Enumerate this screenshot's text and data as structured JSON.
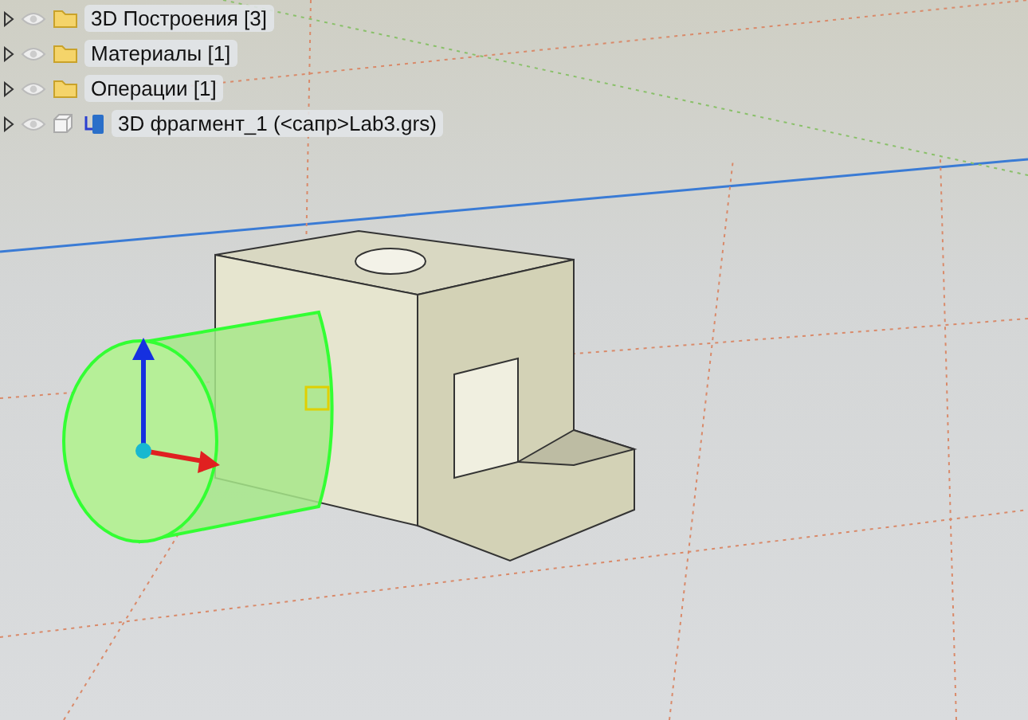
{
  "tree": {
    "items": [
      {
        "label": "3D Построения [3]",
        "kind": "folder"
      },
      {
        "label": "Материалы [1]",
        "kind": "folder"
      },
      {
        "label": "Операции [1]",
        "kind": "folder"
      },
      {
        "label": "3D фрагмент_1 (<сапр>Lab3.grs)",
        "kind": "fragment"
      }
    ]
  }
}
